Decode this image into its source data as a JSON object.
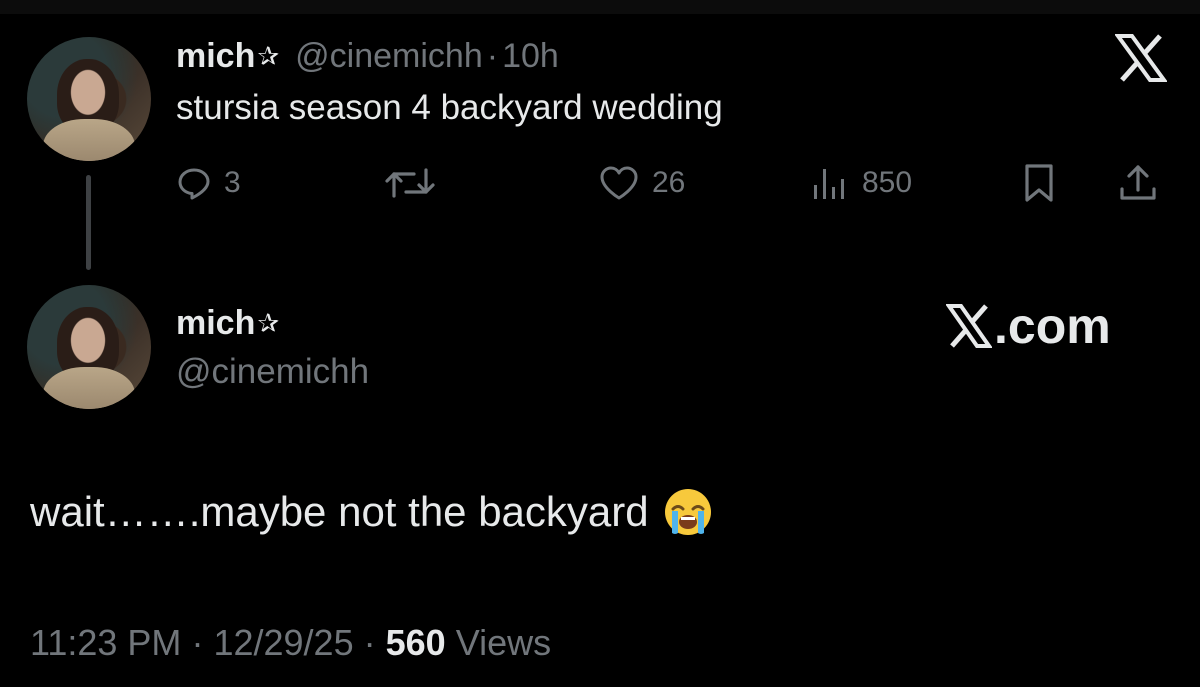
{
  "tweet": {
    "display_name": "mich",
    "star_glyph": "✰",
    "handle": "@cinemichh",
    "separator": "·",
    "time": "10h",
    "text": "stursia season 4 backyard wedding",
    "replies": "3",
    "likes": "26",
    "views": "850"
  },
  "reply": {
    "display_name": "mich",
    "star_glyph": "✰",
    "handle": "@cinemichh",
    "brand": ".com",
    "text": "wait…….maybe not the backyard",
    "time": "11:23 PM",
    "date": "12/29/25",
    "separator": "·",
    "views_count": "560",
    "views_label": "Views"
  },
  "icons": {
    "top_right": "x-logo-icon",
    "reply": "reply-icon",
    "retweet": "retweet-icon",
    "like": "heart-icon",
    "views": "views-icon",
    "bookmark": "bookmark-icon",
    "share": "share-icon",
    "emoji": "loudly-crying-face-icon"
  },
  "colors": {
    "background": "#000000",
    "text": "#e7e9ea",
    "muted": "#71767b",
    "thread_line": "#3e4144"
  }
}
